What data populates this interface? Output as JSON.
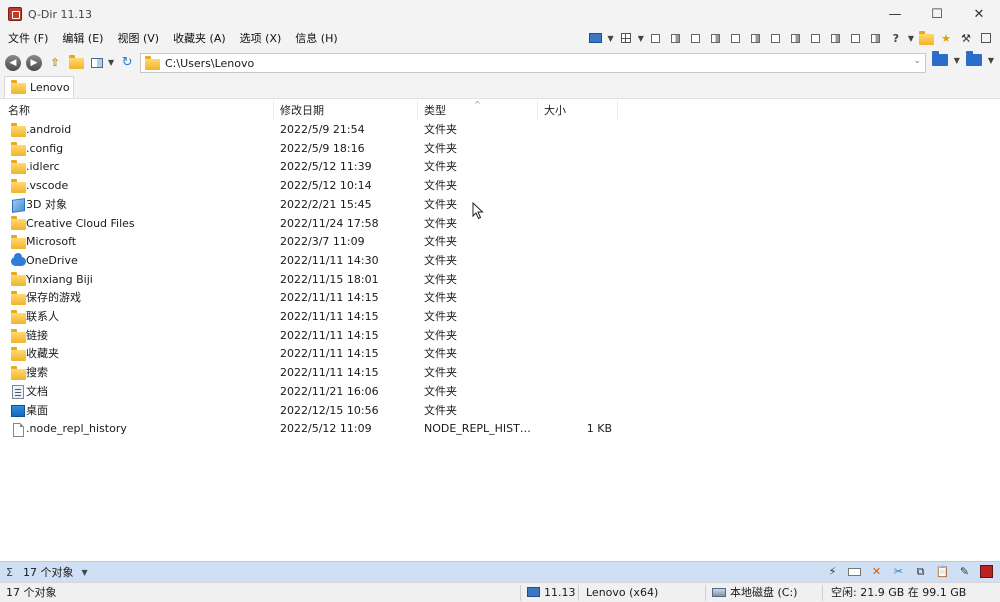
{
  "window": {
    "title": "Q-Dir 11.13",
    "minimize": "—",
    "maximize": "☐",
    "close": "✕"
  },
  "menu": [
    "文件 (F)",
    "编辑 (E)",
    "视图 (V)",
    "收藏夹 (A)",
    "选项 (X)",
    "信息 (H)"
  ],
  "address": {
    "path": "C:\\Users\\Lenovo"
  },
  "tab": {
    "label": "Lenovo"
  },
  "columns": {
    "name": "名称",
    "date": "修改日期",
    "type": "类型",
    "size": "大小"
  },
  "files": [
    {
      "icon": "folder-icon",
      "name": ".android",
      "date": "2022/5/9 21:54",
      "type": "文件夹",
      "size": ""
    },
    {
      "icon": "folder-icon",
      "name": ".config",
      "date": "2022/5/9 18:16",
      "type": "文件夹",
      "size": ""
    },
    {
      "icon": "folder-icon",
      "name": ".idlerc",
      "date": "2022/5/12 11:39",
      "type": "文件夹",
      "size": ""
    },
    {
      "icon": "folder-icon",
      "name": ".vscode",
      "date": "2022/5/12 10:14",
      "type": "文件夹",
      "size": ""
    },
    {
      "icon": "3d-objects-icon",
      "name": "3D 对象",
      "date": "2022/2/21 15:45",
      "type": "文件夹",
      "size": ""
    },
    {
      "icon": "folder-icon",
      "name": "Creative Cloud Files",
      "date": "2022/11/24 17:58",
      "type": "文件夹",
      "size": ""
    },
    {
      "icon": "folder-icon",
      "name": "Microsoft",
      "date": "2022/3/7 11:09",
      "type": "文件夹",
      "size": ""
    },
    {
      "icon": "onedrive-icon",
      "name": "OneDrive",
      "date": "2022/11/11 14:30",
      "type": "文件夹",
      "size": ""
    },
    {
      "icon": "folder-icon",
      "name": "Yinxiang Biji",
      "date": "2022/11/15 18:01",
      "type": "文件夹",
      "size": ""
    },
    {
      "icon": "folder-icon",
      "name": "保存的游戏",
      "date": "2022/11/11 14:15",
      "type": "文件夹",
      "size": ""
    },
    {
      "icon": "folder-icon",
      "name": "联系人",
      "date": "2022/11/11 14:15",
      "type": "文件夹",
      "size": ""
    },
    {
      "icon": "folder-icon",
      "name": "链接",
      "date": "2022/11/11 14:15",
      "type": "文件夹",
      "size": ""
    },
    {
      "icon": "folder-icon",
      "name": "收藏夹",
      "date": "2022/11/11 14:15",
      "type": "文件夹",
      "size": ""
    },
    {
      "icon": "folder-icon",
      "name": "搜索",
      "date": "2022/11/11 14:15",
      "type": "文件夹",
      "size": ""
    },
    {
      "icon": "documents-icon",
      "name": "文档",
      "date": "2022/11/21 16:06",
      "type": "文件夹",
      "size": ""
    },
    {
      "icon": "desktop-icon",
      "name": "桌面",
      "date": "2022/12/15 10:56",
      "type": "文件夹",
      "size": ""
    },
    {
      "icon": "file-icon",
      "name": ".node_repl_history",
      "date": "2022/5/12 11:09",
      "type": "NODE_REPL_HISTO...",
      "size": "1 KB"
    }
  ],
  "bottom": {
    "count_label": "17 个对象"
  },
  "status": {
    "objects": "17 个对象",
    "version": "11.13",
    "user": "Lenovo (x64)",
    "drive": "本地磁盘 (C:)",
    "space": "空闲: 21.9 GB 在 99.1 GB"
  },
  "colors": {
    "accent": "#2b6ec9",
    "folder": "#f0b429",
    "bottom_bar": "#cfe0f4"
  }
}
